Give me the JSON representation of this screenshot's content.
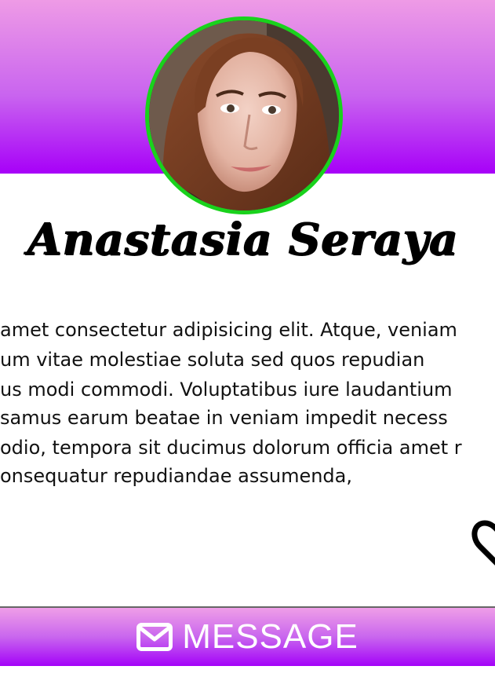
{
  "profile": {
    "name": "Anastasia Seraya",
    "avatar_icon": "profile-photo",
    "avatar_border_color": "#19d21c"
  },
  "bio": {
    "lines": [
      "amet consectetur adipisicing elit. Atque, veniam",
      "um vitae molestiae soluta sed quos repudian",
      "us modi commodi. Voluptatibus iure laudantium",
      "samus earum beatae in veniam impedit necess",
      "odio, tempora sit ducimus dolorum officia amet r",
      "onsequatur repudiandae assumenda,"
    ]
  },
  "like": {
    "icon": "heart-icon"
  },
  "message_button": {
    "label": "MESSAGE",
    "icon": "envelope-icon"
  },
  "colors": {
    "header_top": "#ee9be6",
    "header_bottom": "#a700f8",
    "accent": "#19d21c"
  }
}
